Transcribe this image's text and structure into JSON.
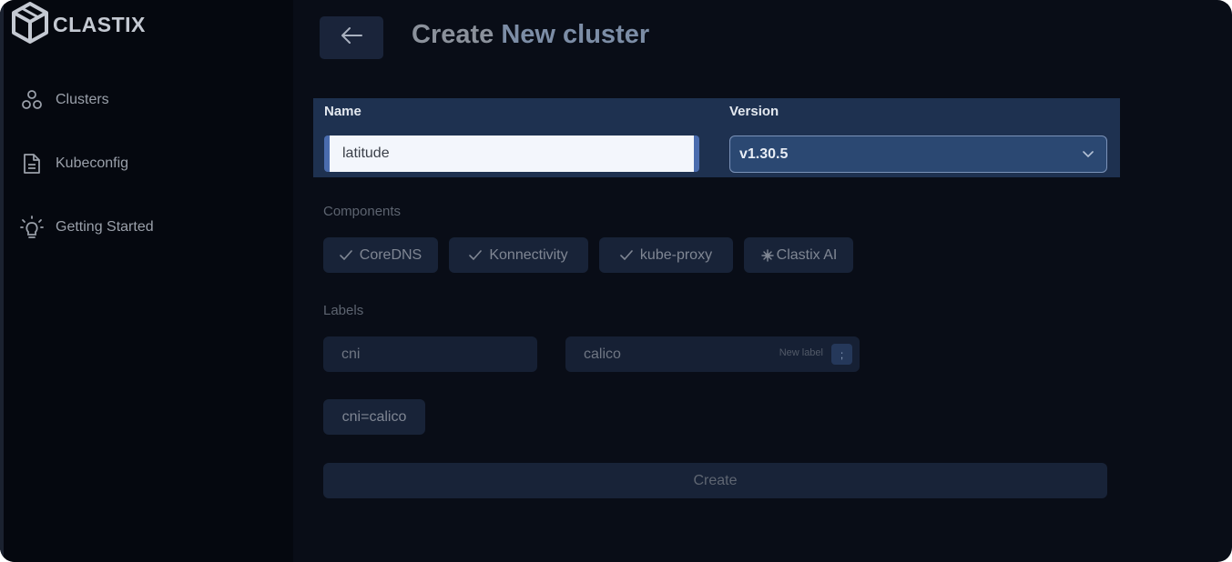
{
  "brand": {
    "name": "CLASTIX",
    "logo_icon": "clastix-cube-logo-icon"
  },
  "sidebar": {
    "items": [
      {
        "label": "Clusters",
        "icon": "clusters-icon"
      },
      {
        "label": "Kubeconfig",
        "icon": "document-icon"
      },
      {
        "label": "Getting Started",
        "icon": "lightbulb-icon"
      }
    ]
  },
  "header": {
    "back_icon": "arrow-left-icon",
    "title_prefix": "Create",
    "title_accent": "New cluster"
  },
  "form": {
    "name_label": "Name",
    "name_value": "latitude",
    "version_label": "Version",
    "version_value": "v1.30.5",
    "version_icon": "chevron-down-icon"
  },
  "components": {
    "label": "Components",
    "chips": [
      {
        "label": "CoreDNS",
        "icon": "check-icon"
      },
      {
        "label": "Konnectivity",
        "icon": "check-icon"
      },
      {
        "label": "kube-proxy",
        "icon": "check-icon"
      },
      {
        "label": "Clastix AI",
        "icon": "sparkle-icon"
      }
    ]
  },
  "labels": {
    "label": "Labels",
    "key_value": "cni",
    "val_value": "calico",
    "hint": "New label",
    "kbd": ";",
    "tags": [
      "cni=calico"
    ]
  },
  "actions": {
    "create_label": "Create"
  },
  "colors": {
    "background": "#090d17",
    "sidebar": "#05080f",
    "form_highlight": "#1e3150",
    "select": "#2b4872",
    "chip": "#182338"
  }
}
